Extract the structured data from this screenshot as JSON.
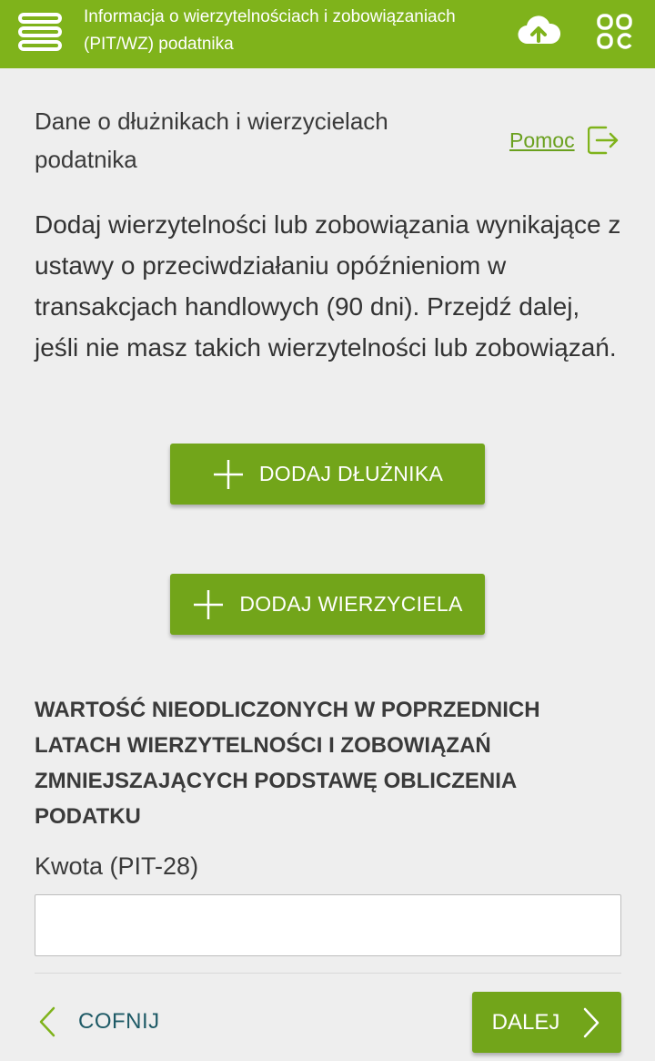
{
  "appbar": {
    "title": "Informacja o wierzytelnościach i zobowiązaniach (PIT/WZ) podatnika",
    "menu_icon": "menu-icon",
    "upload_icon": "cloud-upload-icon",
    "apps_icon": "apps-grid-icon",
    "color": "#7fb31b"
  },
  "section": {
    "title": "Dane o dłużnikach i wierzycielach podatnika",
    "help_label": "Pomoc",
    "help_icon": "open-external-icon"
  },
  "intro": "Dodaj wierzytelności lub zobowiązania wynikające z ustawy o przeciwdziałaniu opóźnieniom w transakcjach handlowych (90 dni). Przejdź dalej, jeśli nie masz takich wierzytelności lub zobowiązań.",
  "actions": {
    "add_debtor": "DODAJ DŁUŻNIKA",
    "add_creditor": "DODAJ WIERZYCIELA",
    "button_color": "#72a51a"
  },
  "value_section": {
    "heading": "WARTOŚĆ NIEODLICZONYCH W POPRZEDNICH LATACH WIERZYTELNOŚCI I ZOBOWIĄZAŃ ZMNIEJSZAJĄCYCH PODSTAWĘ OBLICZENIA PODATKU",
    "amount_label": "Kwota (PIT-28)",
    "amount_value": ""
  },
  "footer": {
    "back_label": "COFNIJ",
    "next_label": "DALEJ"
  }
}
